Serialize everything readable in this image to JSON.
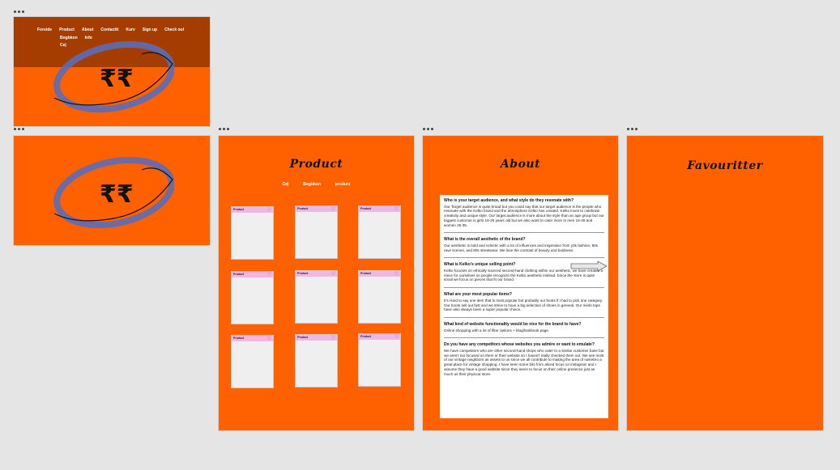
{
  "frames": {
    "home_nav": {
      "nav_items_row1": [
        "Forside",
        "Product",
        "About",
        "Contacttt",
        "Kurv",
        "Sign up",
        "Check out"
      ],
      "nav_items_row2": [
        "Bogbkon",
        "Info"
      ],
      "nav_items_row3": [
        "Cej"
      ]
    },
    "home": {},
    "product": {
      "title": "Product",
      "subnav": [
        "Cej",
        "Bogbkon",
        "product"
      ],
      "card_label": "Product"
    },
    "about": {
      "title": "About",
      "qa": [
        {
          "q": "Who is your target audience, and what style do they resonate with?",
          "a": "Our Target audience is quite broad but you could say that our target audience is the people who resonate with the Kelko brand and the atmosphere Kelko has created. Kelko loves to celebrate creativity and unique style. Our target audience is more about the style than an age group but our biggest customer is girls 16-25 years old but we also want to cater more to men 16-35 and women 25-35."
        },
        {
          "q": "What is the overall aesthetic of the brand?",
          "a": "Our aesthetic is bold and eclectic with a lot of influences and inspiration from y2k fashion, 90s rave scenes, and 80s streetwear. We love the contrast of beauty and boldness."
        },
        {
          "q": "What is Kelko's unique selling point?",
          "a": "Kelko focuses on ethically sourced second-hand clothing within our aesthetic, we have created a niece for ourselves so people recognize the Kelko aesthetic instead. Since the store is quite small we focus on pieces that fit our brand."
        },
        {
          "q": "What are your most popular items?",
          "a": "It's Hard to say one item that is most popular but probably our boots if I had to pick one category. Our boots sell out fast and we strive to have a big selection of shoes in general. Our mesh tops have also always been a super popular choice."
        },
        {
          "q": "What kind of website functionality would be nice for the brand to have?",
          "a": "Online shopping with a lot of filter options + blog/lookbook page."
        },
        {
          "q": "Do you have any competitors whose websites you admire or want to emulate?",
          "a": "We have competitors who are other second-hand shops who cater to a similar customer base but we aren't too focused on them or their website so I haven't really checked them out. We see most of our vintage neighbors as assets to us since we all contribute to making the area of nørrebro a great place for vintage shopping. I have seen some bits from aliced focus on instagram and I assume they have a good website since they seem to focus on their online presence just as much as their physical store."
        }
      ]
    },
    "favourites": {
      "title": "Favouritter"
    },
    "colors": {
      "frame_orange": "#ff6100",
      "nav_band": "#a53c00",
      "logo_ring": "#5c6db5",
      "card_top": "#f0b7e6",
      "canvas": "#e5e5e5"
    },
    "icons": [
      "heart-icon",
      "frame-handle-icon",
      "logo-emblem",
      "arrow-icon"
    ]
  }
}
